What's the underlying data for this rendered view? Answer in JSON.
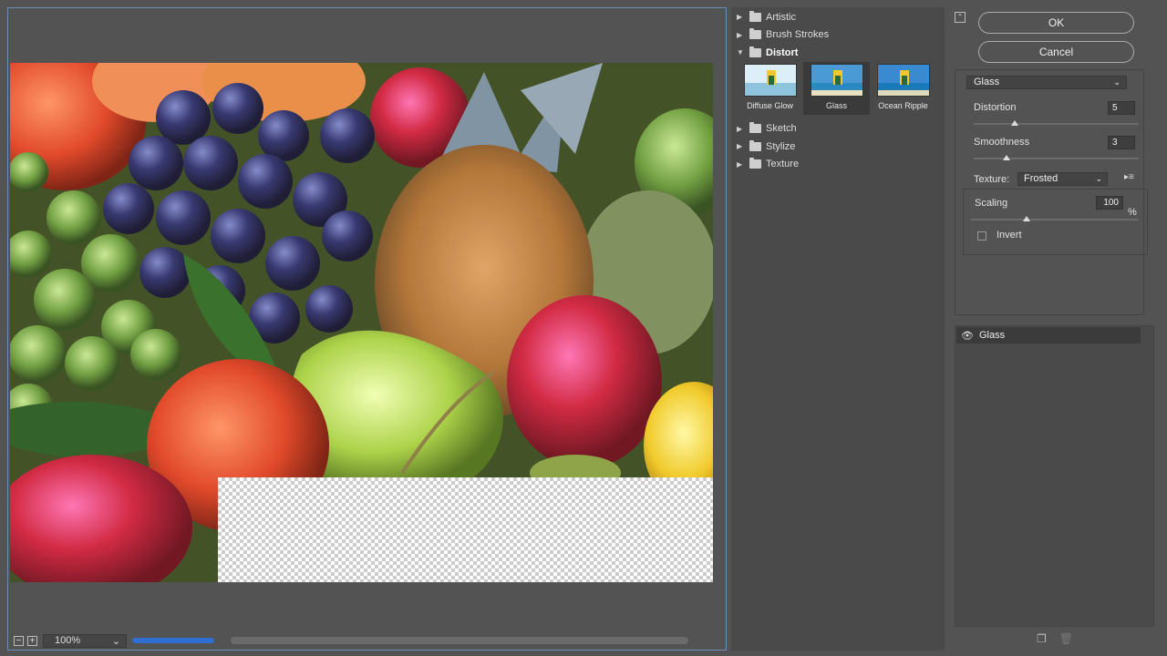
{
  "preview": {
    "zoom_out": "−",
    "zoom_in": "+",
    "zoom_value": "100%",
    "zoom_chevron": "⌄"
  },
  "gallery": {
    "categories": [
      {
        "label": "Artistic",
        "open": false
      },
      {
        "label": "Brush Strokes",
        "open": false
      },
      {
        "label": "Distort",
        "open": true
      },
      {
        "label": "Sketch",
        "open": false
      },
      {
        "label": "Stylize",
        "open": false
      },
      {
        "label": "Texture",
        "open": false
      }
    ],
    "distort_filters": [
      {
        "label": "Diffuse Glow",
        "selected": false
      },
      {
        "label": "Glass",
        "selected": true
      },
      {
        "label": "Ocean Ripple",
        "selected": false
      }
    ]
  },
  "settings": {
    "ok_label": "OK",
    "cancel_label": "Cancel",
    "filter_select": "Glass",
    "distortion_label": "Distortion",
    "distortion_value": "5",
    "distortion_level": 0.25,
    "smoothness_label": "Smoothness",
    "smoothness_value": "3",
    "smoothness_level": 0.2,
    "texture_label": "Texture:",
    "texture_value": "Frosted",
    "scaling_label": "Scaling",
    "scaling_value": "100",
    "scaling_unit": "%",
    "scaling_level": 0.33,
    "invert_label": "Invert",
    "invert_checked": false
  },
  "layers": {
    "items": [
      {
        "label": "Glass",
        "visible": true
      }
    ]
  }
}
